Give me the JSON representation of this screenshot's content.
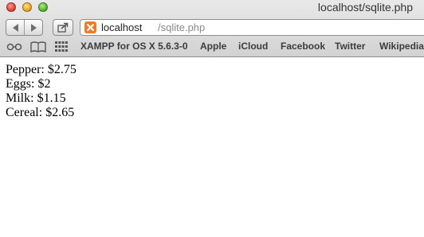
{
  "window": {
    "title": "localhost/sqlite.php"
  },
  "address": {
    "host": "localhost",
    "path": "/sqlite.php"
  },
  "bookmarks": {
    "icons": [
      "reading-list-icon",
      "bookmarks-book-icon",
      "top-sites-grid-icon"
    ],
    "items": [
      {
        "label": "XAMPP for OS X 5.6.3-0"
      },
      {
        "label": "Apple"
      },
      {
        "label": "iCloud"
      },
      {
        "label": "Facebook"
      },
      {
        "label": "Twitter"
      },
      {
        "label": "Wikipedia"
      }
    ]
  },
  "content": {
    "lines": [
      {
        "text": "Pepper: $2.75"
      },
      {
        "text": "Eggs: $2"
      },
      {
        "text": "Milk: $1.15"
      },
      {
        "text": "Cereal: $2.65"
      }
    ]
  },
  "colors": {
    "favicon": "#f07a26",
    "close": "#e2463c",
    "minimize": "#e9a92a",
    "zoom": "#5cb735"
  }
}
